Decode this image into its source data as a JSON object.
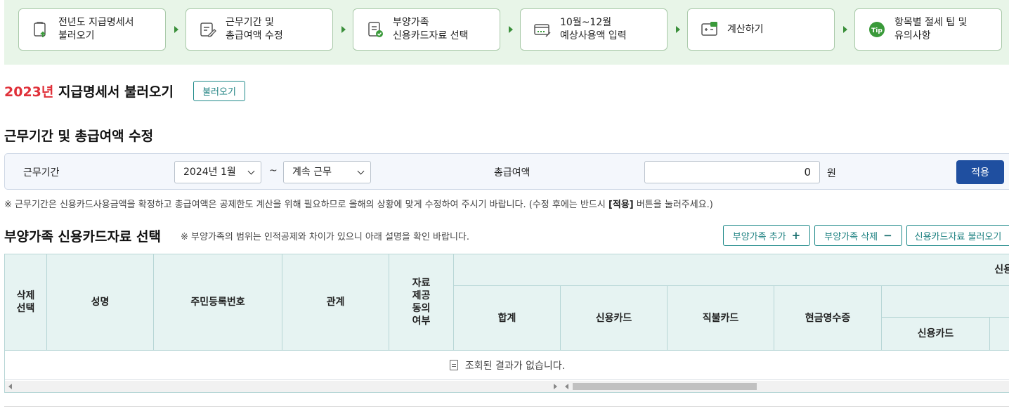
{
  "steps": [
    {
      "label": "전년도 지급명세서\n불러오기",
      "icon": "document-import-icon"
    },
    {
      "label": "근무기간 및\n총급여액 수정",
      "icon": "edit-document-icon"
    },
    {
      "label": "부양가족\n신용카드자료 선택",
      "icon": "checklist-icon"
    },
    {
      "label": "10월~12월\n예상사용액 입력",
      "icon": "card-input-icon"
    },
    {
      "label": "계산하기",
      "icon": "calculator-icon"
    },
    {
      "label": "항목별 절세 팁 및\n유의사항",
      "icon": "tip-icon"
    }
  ],
  "load": {
    "year": "2023년",
    "title": " 지급명세서 불러오기",
    "button": "불러오기"
  },
  "period": {
    "heading": "근무기간 및 총급여액 수정",
    "label": "근무기간",
    "start": "2024년 1월",
    "tilde": "~",
    "end": "계속 근무",
    "total_label": "총급여액",
    "total_value": "0",
    "unit": "원",
    "apply": "적용",
    "note_pre": "※ 근무기간은 신용카드사용금액을 확정하고 총급여액은 공제한도 계산을 위해 필요하므로 올해의 상황에 맞게 수정하여 주시기 바랍니다. (수정 후에는 반드시 ",
    "note_bold": "[적용]",
    "note_post": " 버튼을 눌러주세요.)"
  },
  "dependents": {
    "heading": "부양가족 신용카드자료 선택",
    "subnote": "※ 부양가족의 범위는 인적공제와 차이가 있으니 아래 설명을 확인 바랍니다.",
    "add": "부양가족 추가",
    "add_glyph": "+",
    "delete": "부양가족 삭제",
    "delete_glyph": "−",
    "load_card": "신용카드자료 불러오기",
    "columns": {
      "del": "삭제\n선택",
      "name": "성명",
      "rrn": "주민등록번호",
      "rel": "관계",
      "consent": "자료\n제공\n동의\n여부",
      "group": "신용",
      "sum": "합계",
      "credit": "신용카드",
      "debit": "직불카드",
      "cash": "현금영수증",
      "sub_credit": "신용카드"
    },
    "empty": "조회된 결과가 없습니다."
  },
  "colors": {
    "accent": "#1f4fa0",
    "teal": "#1a7f7f",
    "year": "#e0313a",
    "stepbar": "#e8f5e8"
  }
}
